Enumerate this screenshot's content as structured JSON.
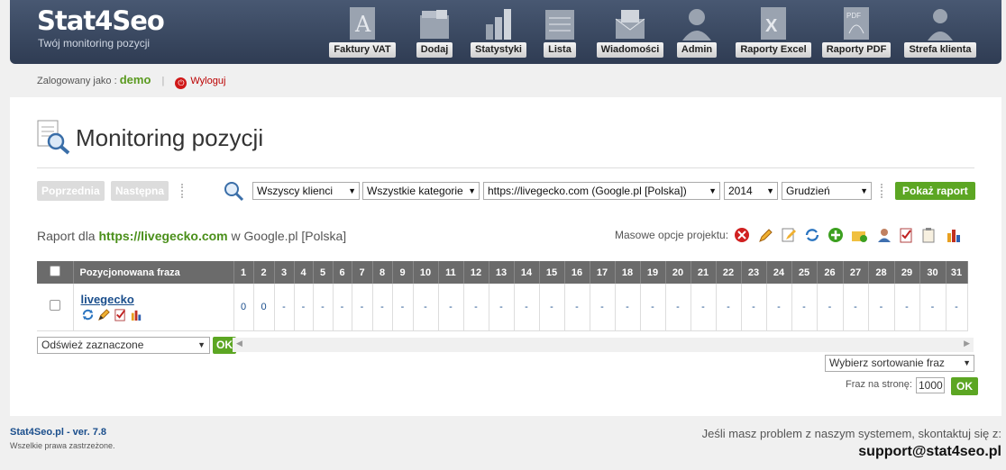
{
  "header": {
    "logo": "Stat4Seo",
    "slogan": "Twój monitoring pozycji",
    "nav": [
      {
        "label": "Faktury VAT",
        "icon": "invoice-icon"
      },
      {
        "label": "Dodaj",
        "icon": "add-folder-icon"
      },
      {
        "label": "Statystyki",
        "icon": "stats-icon"
      },
      {
        "label": "Lista",
        "icon": "list-icon"
      },
      {
        "label": "Wiadomości",
        "icon": "mail-icon"
      },
      {
        "label": "Admin",
        "icon": "admin-icon"
      },
      {
        "label": "Raporty Excel",
        "icon": "excel-icon"
      },
      {
        "label": "Raporty PDF",
        "icon": "pdf-icon"
      },
      {
        "label": "Strefa klienta",
        "icon": "client-icon"
      }
    ]
  },
  "session": {
    "logged_as": "Zalogowany jako :",
    "user": "demo",
    "separator": "|",
    "logout": "Wyloguj"
  },
  "page": {
    "title": "Monitoring pozycji"
  },
  "filters": {
    "prev": "Poprzednia",
    "next": "Następna",
    "clients": "Wszyscy klienci",
    "categories": "Wszystkie kategorie",
    "project": "https://livegecko.com (Google.pl [Polska])",
    "year": "2014",
    "month": "Grudzień",
    "show": "Pokaż raport"
  },
  "report": {
    "prefix": "Raport dla",
    "site": "https://livegecko.com",
    "suffix": "w Google.pl [Polska]",
    "mass": "Masowe opcje projektu:"
  },
  "table": {
    "phrase_header": "Pozycjonowana fraza",
    "days": [
      "1",
      "2",
      "3",
      "4",
      "5",
      "6",
      "7",
      "8",
      "9",
      "10",
      "11",
      "12",
      "13",
      "14",
      "15",
      "16",
      "17",
      "18",
      "19",
      "20",
      "21",
      "22",
      "23",
      "24",
      "25",
      "26",
      "27",
      "28",
      "29",
      "30",
      "31"
    ],
    "rows": [
      {
        "phrase": "livegecko",
        "values": [
          "0",
          "0",
          "-",
          "-",
          "-",
          "-",
          "-",
          "-",
          "-",
          "-",
          "-",
          "-",
          "-",
          "-",
          "-",
          "-",
          "-",
          "-",
          "-",
          "-",
          "-",
          "-",
          "-",
          "-",
          "-",
          "-",
          "-",
          "-",
          "-",
          "-",
          "-"
        ]
      }
    ]
  },
  "bulk": {
    "action": "Odśwież zaznaczone",
    "ok": "OK"
  },
  "sort": {
    "label": "Wybierz sortowanie fraz"
  },
  "perpage": {
    "label": "Fraz na stronę:",
    "value": "1000",
    "ok": "OK"
  },
  "footer": {
    "version": "Stat4Seo.pl - ver. 7.8",
    "rights": "Wszelkie prawa zastrzeżone.",
    "help": "Jeśli masz problem z naszym systemem, skontaktuj się z:",
    "email": "support@stat4seo.pl"
  }
}
